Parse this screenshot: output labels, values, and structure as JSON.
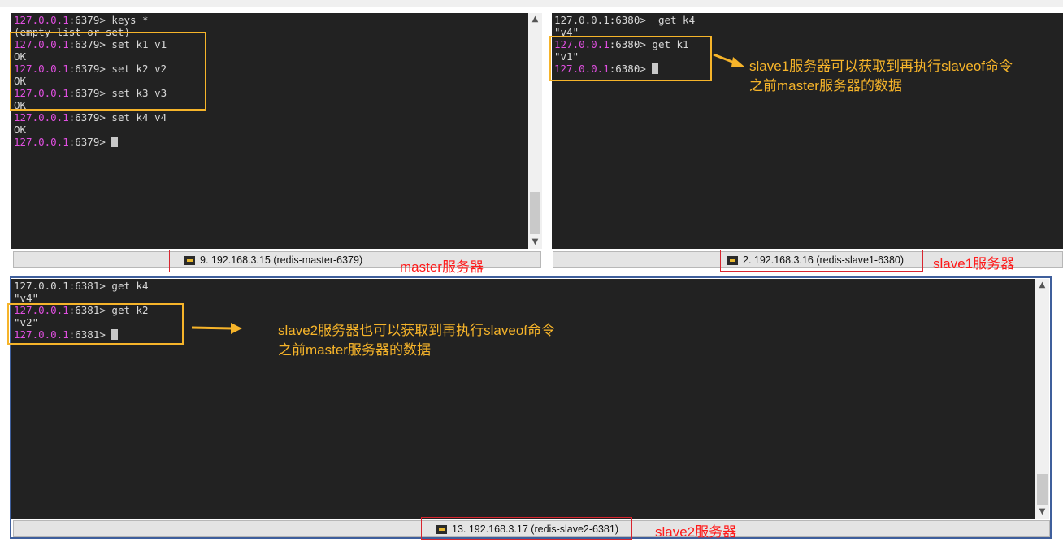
{
  "master": {
    "lines": [
      {
        "ip": "127.0.0.1",
        "rest": ":6379> keys *"
      },
      {
        "text": "(empty list or set)"
      },
      {
        "ip": "127.0.0.1",
        "rest": ":6379> set k1 v1"
      },
      {
        "text": "OK"
      },
      {
        "ip": "127.0.0.1",
        "rest": ":6379> set k2 v2"
      },
      {
        "text": "OK"
      },
      {
        "ip": "127.0.0.1",
        "rest": ":6379> set k3 v3"
      },
      {
        "text": "OK"
      },
      {
        "ip": "127.0.0.1",
        "rest": ":6379> set k4 v4"
      },
      {
        "text": "OK"
      },
      {
        "ip": "127.0.0.1",
        "rest": ":6379> ",
        "cursor": true
      }
    ],
    "tab_label": "9. 192.168.3.15 (redis-master-6379)",
    "caption": "master服务器"
  },
  "slave1": {
    "lines": [
      {
        "ip": "127.0.0.1",
        "rest": ":6380>  get k4",
        "plain": true
      },
      {
        "text": "\"v4\""
      },
      {
        "ip": "127.0.0.1",
        "rest": ":6380> get k1"
      },
      {
        "text": "\"v1\""
      },
      {
        "ip": "127.0.0.1",
        "rest": ":6380> ",
        "cursor": true
      }
    ],
    "tab_label": "2. 192.168.3.16 (redis-slave1-6380)",
    "caption": "slave1服务器",
    "note_line1": "slave1服务器可以获取到再执行slaveof命令",
    "note_line2": "之前master服务器的数据"
  },
  "slave2": {
    "lines": [
      {
        "ip": "127.0.0.1",
        "rest": ":6381> get k4",
        "plain": true
      },
      {
        "text": "\"v4\""
      },
      {
        "ip": "127.0.0.1",
        "rest": ":6381> get k2"
      },
      {
        "text": "\"v2\""
      },
      {
        "ip": "127.0.0.1",
        "rest": ":6381> ",
        "cursor": true
      }
    ],
    "tab_label": "13. 192.168.3.17 (redis-slave2-6381)",
    "caption": "slave2服务器",
    "note_line1": "slave2服务器也可以获取到再执行slaveof命令",
    "note_line2": "之前master服务器的数据"
  },
  "colors": {
    "terminal_bg": "#222222",
    "prompt_ip": "#e04fe0",
    "annotation_orange": "#f6b42a",
    "annotation_red": "#ff1a1a",
    "active_border": "#3f5f9c"
  },
  "icons": [
    "key-icon",
    "scroll-up-icon",
    "scroll-down-icon",
    "arrow-right-icon"
  ]
}
